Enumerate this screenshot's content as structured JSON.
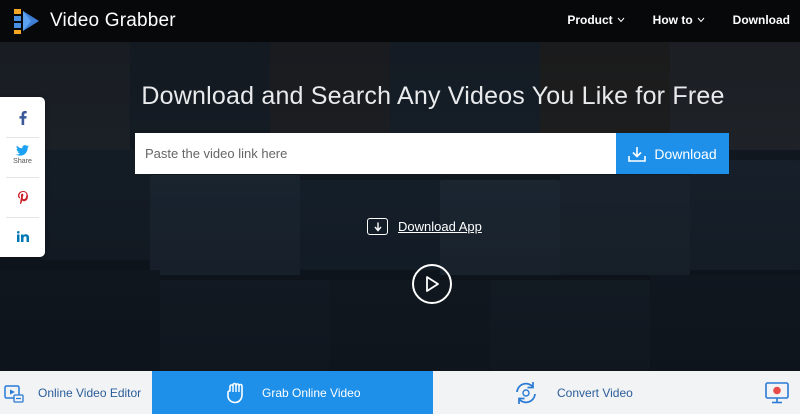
{
  "header": {
    "brand": "Video Grabber",
    "nav": [
      {
        "label": "Product",
        "has_dropdown": true
      },
      {
        "label": "How to",
        "has_dropdown": true
      },
      {
        "label": "Download",
        "has_dropdown": false
      }
    ]
  },
  "hero": {
    "headline": "Download and Search Any Videos You Like for Free",
    "search_placeholder": "Paste the video link here",
    "download_button": "Download",
    "download_app": "Download App"
  },
  "share": {
    "items": [
      {
        "icon": "facebook-icon",
        "label": ""
      },
      {
        "icon": "twitter-icon",
        "label": "Share"
      },
      {
        "icon": "pinterest-icon",
        "label": ""
      },
      {
        "icon": "linkedin-icon",
        "label": ""
      }
    ]
  },
  "tools": [
    {
      "label": "Online Video Editor",
      "icon": "video-editor-icon",
      "active": false
    },
    {
      "label": "Grab Online Video",
      "icon": "grab-hand-icon",
      "active": true
    },
    {
      "label": "Convert Video",
      "icon": "convert-icon",
      "active": false
    },
    {
      "label": "",
      "icon": "screen-record-icon",
      "active": false
    }
  ],
  "colors": {
    "accent": "#1e90ea",
    "topbar": "#060809",
    "tool_text": "#2a5d99",
    "tools_bg": "#f2f3f5",
    "facebook": "#3b5998",
    "twitter": "#1da1f2",
    "pinterest": "#cb2027",
    "linkedin": "#0077b5",
    "record": "#e94b4b"
  }
}
